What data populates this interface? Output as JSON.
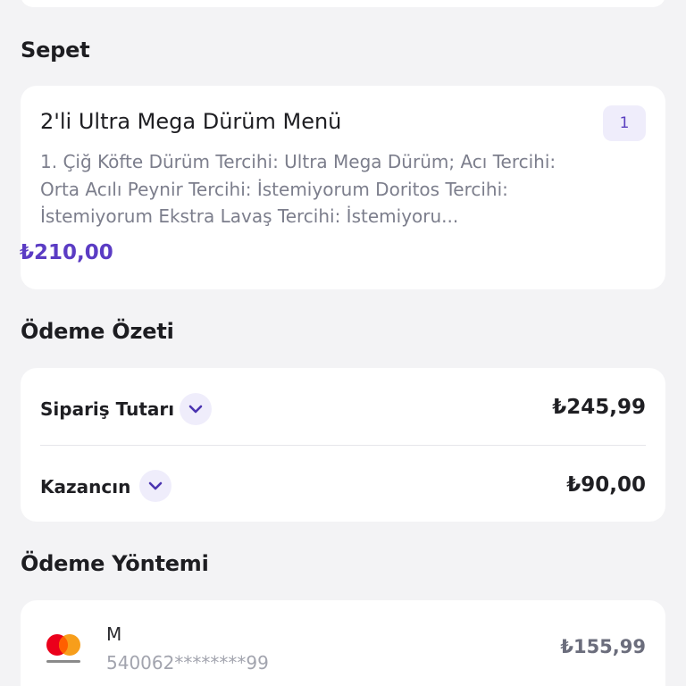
{
  "sections": {
    "cart_title": "Sepet",
    "summary_title": "Ödeme Özeti",
    "payment_title": "Ödeme Yöntemi"
  },
  "cart": {
    "item": {
      "name": "2'li Ultra Mega Dürüm Menü",
      "quantity": "1",
      "description": "1. Çiğ Köfte Dürüm Tercihi: Ultra Mega Dürüm; Acı Tercihi: Orta Acılı Peynir Tercihi: İstemiyorum Doritos Tercihi: İstemiyorum Ekstra Lavaş Tercihi: İstemiyoru...",
      "price": "₺210,00"
    }
  },
  "summary": {
    "order_total_label": "Sipariş Tutarı",
    "order_total_value": "₺245,99",
    "savings_label": "Kazancın",
    "savings_value": "₺90,00"
  },
  "payment": {
    "card_holder": "M",
    "card_number": "540062********99",
    "amount": "₺155,99",
    "card_brand_icon": "mastercard-logo"
  },
  "colors": {
    "accent": "#5b3cc4",
    "badge_bg": "#efedfb",
    "page_bg": "#f3f3f5"
  }
}
